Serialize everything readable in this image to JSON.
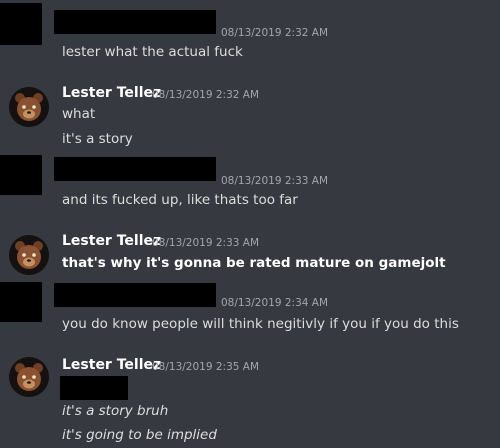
{
  "messages": [
    {
      "author": "",
      "timestamp": "08/13/2019 2:32 AM",
      "lines": [
        "lester what the actual fuck"
      ]
    },
    {
      "author": "Lester Tellez",
      "timestamp": "08/13/2019 2:32 AM",
      "lines": [
        "what",
        "it's a story"
      ]
    },
    {
      "author": "",
      "timestamp": "08/13/2019 2:33 AM",
      "lines": [
        "and its fucked up, like thats too far"
      ]
    },
    {
      "author": "Lester Tellez",
      "timestamp": "08/13/2019 2:33 AM",
      "lines": [
        "that's why it's gonna be rated mature on gamejolt"
      ]
    },
    {
      "author": "",
      "timestamp": "08/13/2019 2:34 AM",
      "lines": [
        "you do know people will think negitivly if you if you do this"
      ]
    },
    {
      "author": "Lester Tellez",
      "timestamp": "08/13/2019 2:35 AM",
      "lines": [
        "it's a story bruh",
        "it's going to be implied"
      ]
    }
  ],
  "colors": {
    "background": "#36393f",
    "username": "#ffffff",
    "timestamp": "#a3a6aa",
    "message_text": "#dcddde",
    "redaction": "#000000"
  },
  "icons": {
    "avatar": "bear-avatar-icon"
  }
}
